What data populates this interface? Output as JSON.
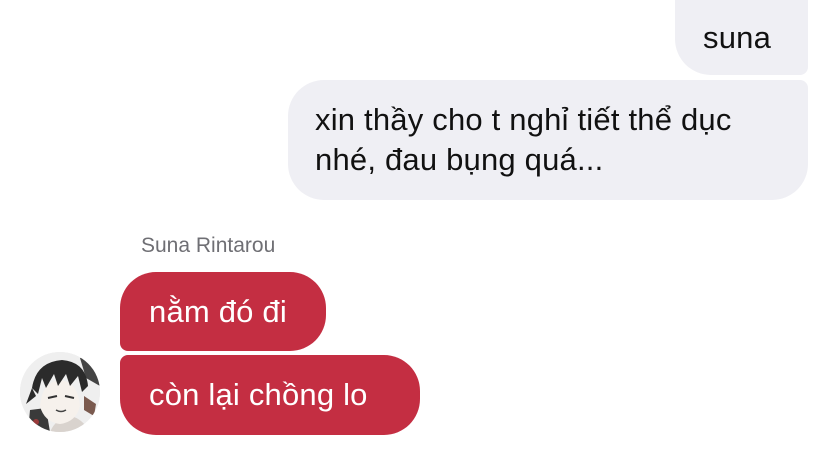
{
  "messages": {
    "outgoing": [
      {
        "text": "suna"
      },
      {
        "line1": "xin thầy cho t nghỉ tiết thể dục",
        "line2": "nhé, đau bụng quá..."
      }
    ],
    "sender_name": "Suna Rintarou",
    "incoming": [
      {
        "text": "nằm đó đi"
      },
      {
        "text": "còn lại chồng lo"
      }
    ]
  },
  "colors": {
    "outgoing_bubble": "#efeff4",
    "incoming_bubble": "#c42e42",
    "sender_name": "#6f6f74"
  },
  "icons": {
    "avatar": "anime-character-avatar"
  }
}
